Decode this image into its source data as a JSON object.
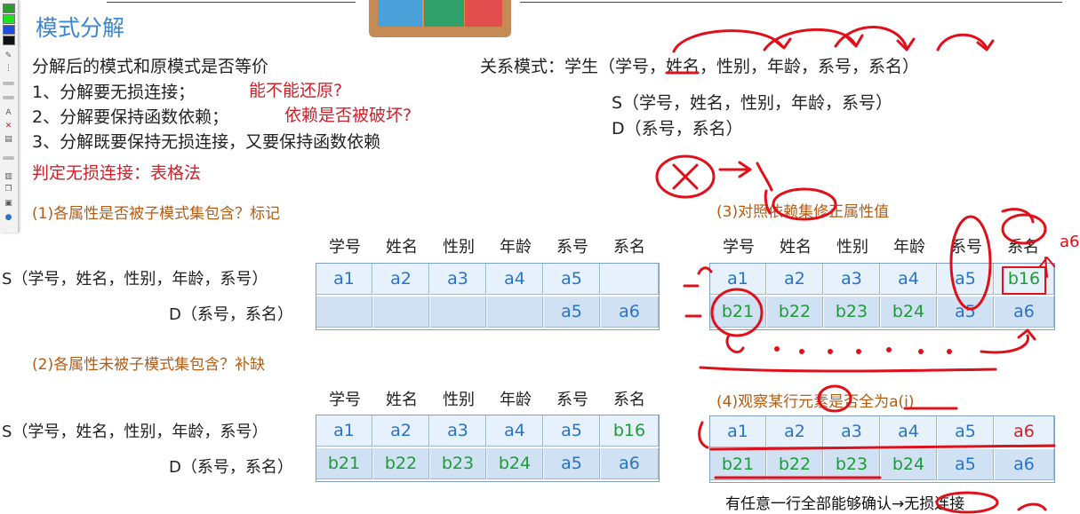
{
  "slide": {
    "title": "模式分解",
    "lines": [
      "分解后的模式和原模式是否等价",
      "1、分解要无损连接；",
      "2、分解要保持函数依赖；",
      "3、分解既要保持无损连接，又要保持函数依赖"
    ],
    "questions": [
      "能不能还原?",
      "依赖是否被破坏?"
    ],
    "method": "判定无损连接：表格法",
    "relation": "关系模式：学生（学号，姓名，性别，年龄，系号，系名）",
    "sub1": "S（学号，姓名，性别，年龄，系号）",
    "sub2": "D（系号，系名）",
    "step1": "(1)各属性是否被子模式集包含？标记",
    "step2": "(2)各属性未被子模式集包含？补缺",
    "step3": "(3)对照依赖集修正属性值",
    "step4": "(4)观察某行元素是否全为a(i)",
    "conclusion": "有任意一行全部能够确认→无损连接",
    "row_s": "S（学号，姓名，性别，年龄，系号）",
    "row_d": "D（系号，系名）",
    "headers": [
      "学号",
      "姓名",
      "性别",
      "年龄",
      "系号",
      "系名"
    ],
    "ink_note": "a6"
  },
  "tables": {
    "t1": {
      "rows": [
        [
          "a1",
          "a2",
          "a3",
          "a4",
          "a5",
          ""
        ],
        [
          "",
          "",
          "",
          "",
          "a5",
          "a6"
        ]
      ]
    },
    "t2": {
      "rows": [
        [
          "a1",
          "a2",
          "a3",
          "a4",
          "a5",
          "b16"
        ],
        [
          "b21",
          "b22",
          "b23",
          "b24",
          "a5",
          "a6"
        ]
      ]
    },
    "t3": {
      "rows": [
        [
          "a1",
          "a2",
          "a3",
          "a4",
          "a5",
          "b16"
        ],
        [
          "b21",
          "b22",
          "b23",
          "b24",
          "a5",
          "a6"
        ]
      ]
    },
    "t4": {
      "rows": [
        [
          "a1",
          "a2",
          "a3",
          "a4",
          "a5",
          "a6"
        ],
        [
          "b21",
          "b22",
          "b23",
          "b24",
          "a5",
          "a6"
        ]
      ]
    }
  },
  "colors": {
    "title": "#3b86cc",
    "question": "#d0202a",
    "step": "#b45c14",
    "a_value": "#2a73c7",
    "b_value": "#1f9a3a",
    "ink": "#e0101a"
  }
}
